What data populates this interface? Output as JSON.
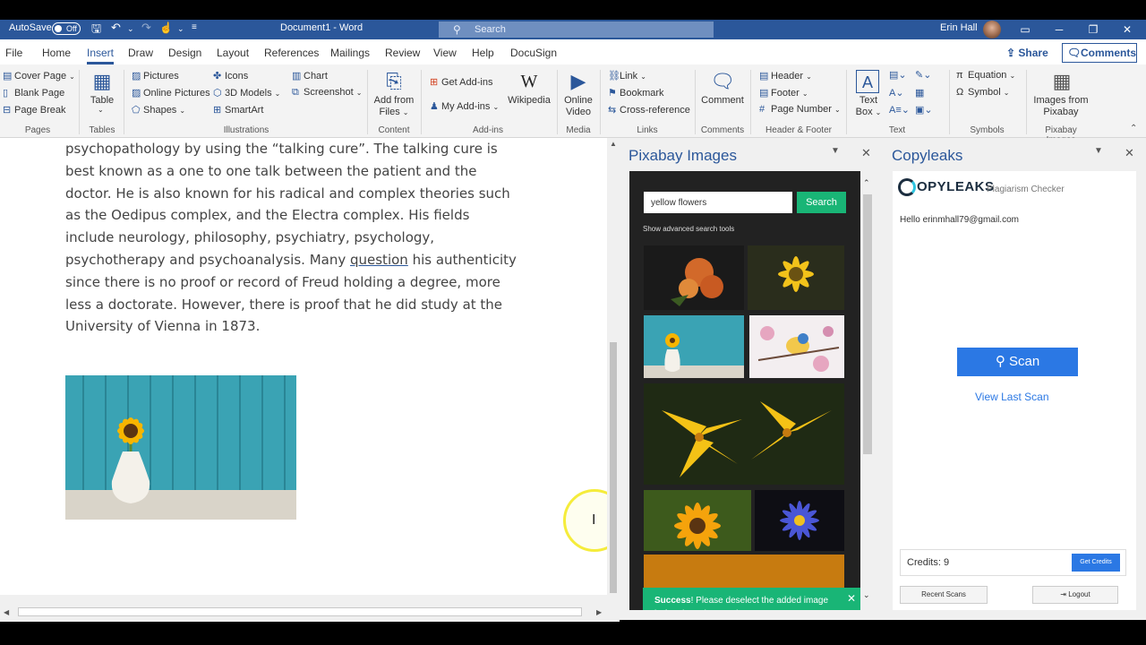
{
  "titlebar": {
    "autosave_label": "AutoSave",
    "autosave_state": "Off",
    "doc_title": "Document1 - Word",
    "search_placeholder": "Search",
    "user_name": "Erin Hall"
  },
  "tabs": [
    "File",
    "Home",
    "Insert",
    "Draw",
    "Design",
    "Layout",
    "References",
    "Mailings",
    "Review",
    "View",
    "Help",
    "DocuSign"
  ],
  "share_label": "Share",
  "comments_label": "Comments",
  "ribbon": {
    "pages": {
      "cover_page": "Cover Page",
      "blank_page": "Blank Page",
      "page_break": "Page Break",
      "group": "Pages"
    },
    "tables": {
      "table": "Table",
      "group": "Tables"
    },
    "illustrations": {
      "pictures": "Pictures",
      "online_pictures": "Online Pictures",
      "shapes": "Shapes",
      "icons": "Icons",
      "models_3d": "3D Models",
      "smartart": "SmartArt",
      "chart": "Chart",
      "screenshot": "Screenshot",
      "group": "Illustrations"
    },
    "content": {
      "add_from_files_1": "Add from",
      "add_from_files_2": "Files",
      "group": "Content"
    },
    "addins": {
      "get_addins": "Get Add-ins",
      "my_addins": "My Add-ins",
      "wikipedia": "Wikipedia",
      "group": "Add-ins"
    },
    "media": {
      "online_video_1": "Online",
      "online_video_2": "Video",
      "group": "Media"
    },
    "links": {
      "link": "Link",
      "bookmark": "Bookmark",
      "cross_reference": "Cross-reference",
      "group": "Links"
    },
    "comments": {
      "comment": "Comment",
      "group": "Comments"
    },
    "header_footer": {
      "header": "Header",
      "footer": "Footer",
      "page_number": "Page Number",
      "group": "Header & Footer"
    },
    "text": {
      "text_box_1": "Text",
      "text_box_2": "Box",
      "group": "Text"
    },
    "symbols": {
      "equation": "Equation",
      "symbol": "Symbol",
      "group": "Symbols"
    },
    "pixabay": {
      "images_from_1": "Images from",
      "images_from_2": "Pixabay",
      "group": "Pixabay Images"
    }
  },
  "document": {
    "lines": [
      "psychopathology by using the “talking cure”. The talking cure is",
      "best known as a one to one talk between the patient and the",
      "doctor. He is also known for his radical and complex theories such",
      "as the Oedipus complex, and the Electra complex. His fields",
      "include neurology, philosophy, psychiatry, psychology,",
      "psychotherapy and psychoanalysis. Many ",
      "since there is no proof or record of Freud holding a degree, more",
      "less a doctorate. However, there is proof that he did study at the",
      "University of Vienna in 1873."
    ],
    "underlined_word": "question",
    "line6_tail": " his authenticity"
  },
  "pixabay_pane": {
    "title": "Pixabay Images",
    "search_value": "yellow flowers",
    "search_button": "Search",
    "advanced_link": "Show advanced search tools",
    "toast_bold": "Success",
    "toast_text": "! Please deselect the added image before inserting another one!"
  },
  "copyleaks_pane": {
    "title": "Copyleaks",
    "logo_text": "OPYLEAKS",
    "subtitle": "Plagiarism Checker",
    "hello": "Hello erinmhall79@gmail.com",
    "scan_label": "Scan",
    "view_last_scan": "View Last Scan",
    "credits_label": "Credits: 9",
    "get_credits": "Get Credits",
    "recent_scans": "Recent Scans",
    "logout": "Logout"
  },
  "colors": {
    "word_blue": "#2b579a",
    "pixabay_green": "#19b576",
    "copyleaks_blue": "#2b78e4"
  }
}
